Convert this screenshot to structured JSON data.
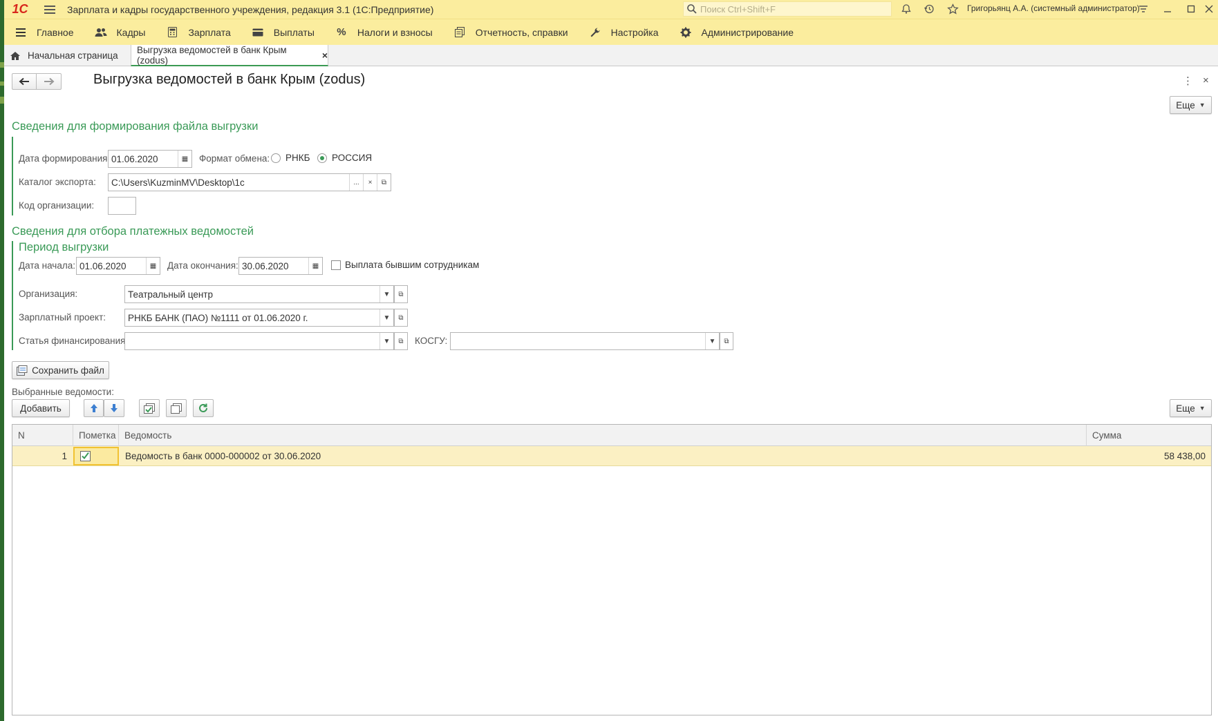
{
  "titlebar": {
    "logo": "1С",
    "app_title": "Зарплата и кадры государственного учреждения, редакция 3.1  (1С:Предприятие)",
    "search_placeholder": "Поиск Ctrl+Shift+F",
    "user": "Григорьянц А.А. (системный администратор)"
  },
  "menu": {
    "items": [
      {
        "label": "Главное",
        "icon": "menu-lines-icon"
      },
      {
        "label": "Кадры",
        "icon": "people-icon"
      },
      {
        "label": "Зарплата",
        "icon": "calculator-icon"
      },
      {
        "label": "Выплаты",
        "icon": "wallet-icon"
      },
      {
        "label": "Налоги и взносы",
        "icon": "percent-icon"
      },
      {
        "label": "Отчетность, справки",
        "icon": "documents-icon"
      },
      {
        "label": "Настройка",
        "icon": "wrench-icon"
      },
      {
        "label": "Администрирование",
        "icon": "gear-icon"
      }
    ]
  },
  "tabs": {
    "home": "Начальная страница",
    "active": "Выгрузка ведомостей в банк Крым (zodus)"
  },
  "form": {
    "title": "Выгрузка ведомостей в банк Крым (zodus)",
    "more_label": "Еще",
    "section1": {
      "heading": "Сведения для формирования файла выгрузки",
      "date_label": "Дата формирования:",
      "date_value": "01.06.2020",
      "format_label": "Формат обмена:",
      "format_options": [
        "РНКБ",
        "РОССИЯ"
      ],
      "format_selected": "РОССИЯ",
      "catalog_label": "Каталог экспорта:",
      "catalog_value": "C:\\Users\\KuzminMV\\Desktop\\1c",
      "catalog_select_btn": "...",
      "catalog_clear_btn": "×",
      "org_code_label": "Код организации:",
      "org_code_value": ""
    },
    "section2": {
      "heading": "Сведения для отбора платежных ведомостей",
      "period_heading": "Период выгрузки",
      "start_label": "Дата начала:",
      "start_value": "01.06.2020",
      "end_label": "Дата окончания:",
      "end_value": "30.06.2020",
      "former_label": "Выплата бывшим сотрудникам",
      "former_checked": false,
      "org_label": "Организация:",
      "org_value": "Театральный центр",
      "project_label": "Зарплатный проект:",
      "project_value": "РНКБ БАНК (ПАО) №1111 от 01.06.2020 г.",
      "funding_label": "Статья финансирования:",
      "funding_value": "",
      "kosgu_label": "КОСГУ:",
      "kosgu_value": ""
    },
    "save_button": "Сохранить файл",
    "list_label": "Выбранные ведомости:",
    "add_button": "Добавить"
  },
  "table": {
    "headers": {
      "n": "N",
      "mark": "Пометка",
      "doc": "Ведомость",
      "sum": "Сумма"
    },
    "rows": [
      {
        "n": "1",
        "checked": true,
        "doc": "Ведомость в банк 0000-000002 от 30.06.2020",
        "sum": "58 438,00"
      }
    ]
  }
}
